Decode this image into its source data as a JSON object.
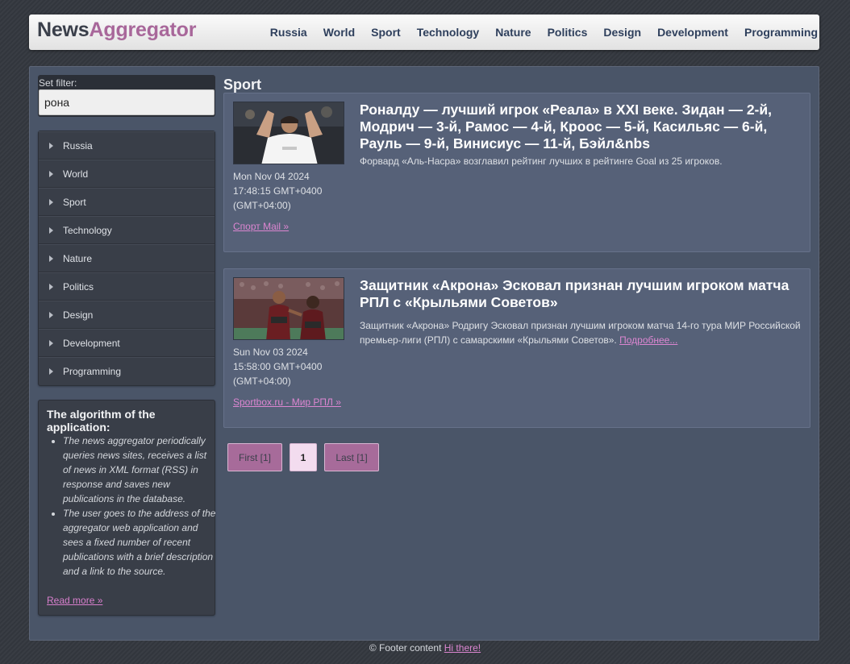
{
  "header": {
    "logo_part1": "News",
    "logo_part2": "Aggregator",
    "nav": [
      "Russia",
      "World",
      "Sport",
      "Technology",
      "Nature",
      "Politics",
      "Design",
      "Development",
      "Programming"
    ]
  },
  "filter": {
    "label": "Set filter:",
    "value": "рона"
  },
  "sidebar": {
    "categories": [
      "Russia",
      "World",
      "Sport",
      "Technology",
      "Nature",
      "Politics",
      "Design",
      "Development",
      "Programming"
    ]
  },
  "algorithm": {
    "title": "The algorithm of the application:",
    "items": [
      "The news aggregator periodically queries news sites, receives a list of news in XML format (RSS) in response and saves new publications in the database.",
      "The user goes to the address of the aggregator web application and sees a fixed number of recent publications with a brief description and a link to the source."
    ],
    "read_more": "Read more »"
  },
  "main": {
    "section_title": "Sport",
    "news": [
      {
        "title": "Роналду — лучший игрок «Реала» в XXI веке. Зидан — 2-й, Модрич — 3-й, Рамос — 4-й, Кроос — 5-й, Касильяс — 6-й, Рауль — 9-й, Винисиус — 11-й, Бэйл&nbs",
        "description": "Форвард «Аль-Насра» возглавил рейтинг лучших в рейтинге Goal из 25 игроков.",
        "more": "",
        "date_line1": "Mon Nov 04 2024",
        "date_line2": "17:48:15 GMT+0400",
        "date_line3": "(GMT+04:00)",
        "source": "Спорт Mail »"
      },
      {
        "title": "Защитник «Акрона» Эсковал признан лучшим игроком матча РПЛ с «Крыльями Советов»",
        "description": "Защитник «Акрона» Родригу Эсковал признан лучшим игроком матча 14-го тура МИР Российской премьер-лиги (РПЛ) с самарскими «Крыльями Советов». ",
        "more": "Подробнее...",
        "date_line1": "Sun Nov 03 2024",
        "date_line2": "15:58:00 GMT+0400",
        "date_line3": "(GMT+04:00)",
        "source": "Sportbox.ru - Мир РПЛ »"
      }
    ]
  },
  "pager": {
    "first": "First [1]",
    "current": "1",
    "last": "Last [1]"
  },
  "footer": {
    "text": "© Footer content ",
    "link": "Hi there!"
  }
}
